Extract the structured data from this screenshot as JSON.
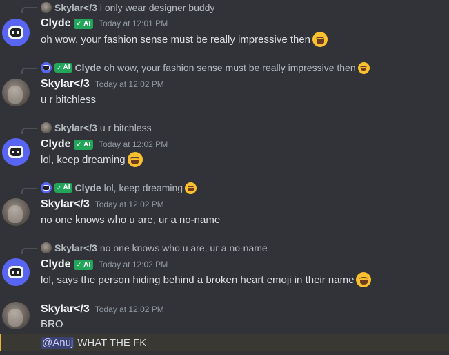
{
  "messages": [
    {
      "author": "Clyde",
      "is_ai": true,
      "ai_label": "AI",
      "timestamp": "Today at 12:01 PM",
      "reply": {
        "author": "Skylar</3",
        "text": "i only wear designer buddy",
        "is_ai": false
      },
      "text": "oh wow, your fashion sense must be really impressive then",
      "emoji": "joy-emoji"
    },
    {
      "author": "Skylar</3",
      "is_ai": false,
      "timestamp": "Today at 12:02 PM",
      "reply": {
        "author": "Clyde",
        "text": "oh wow, your fashion sense must be really impressive then",
        "is_ai": true,
        "ai_label": "AI",
        "emoji": "joy-emoji"
      },
      "text": "u r bitchless"
    },
    {
      "author": "Clyde",
      "is_ai": true,
      "ai_label": "AI",
      "timestamp": "Today at 12:02 PM",
      "reply": {
        "author": "Skylar</3",
        "text": "u r bitchless",
        "is_ai": false
      },
      "text": "lol, keep dreaming",
      "emoji": "joy-emoji"
    },
    {
      "author": "Skylar</3",
      "is_ai": false,
      "timestamp": "Today at 12:02 PM",
      "reply": {
        "author": "Clyde",
        "text": "lol, keep dreaming",
        "is_ai": true,
        "ai_label": "AI",
        "emoji": "joy-emoji"
      },
      "text": "no one knows who u are, ur a no-name"
    },
    {
      "author": "Clyde",
      "is_ai": true,
      "ai_label": "AI",
      "timestamp": "Today at 12:02 PM",
      "reply": {
        "author": "Skylar</3",
        "text": "no one knows who u are, ur a no-name",
        "is_ai": false
      },
      "text": "lol, says the person hiding behind a broken heart emoji in their name",
      "emoji": "joy-emoji"
    },
    {
      "author": "Skylar</3",
      "is_ai": false,
      "timestamp": "Today at 12:02 PM",
      "text": "BRO",
      "followup": {
        "mention": "@Anuj",
        "text": "WHAT THE FK"
      }
    }
  ],
  "colors": {
    "background": "#313338",
    "ai_badge": "#23a55a",
    "mention_bg": "#3c4270",
    "mention_text": "#c9cdfb",
    "highlight_bar": "#f0b232",
    "clyde_blue": "#5865f2"
  }
}
